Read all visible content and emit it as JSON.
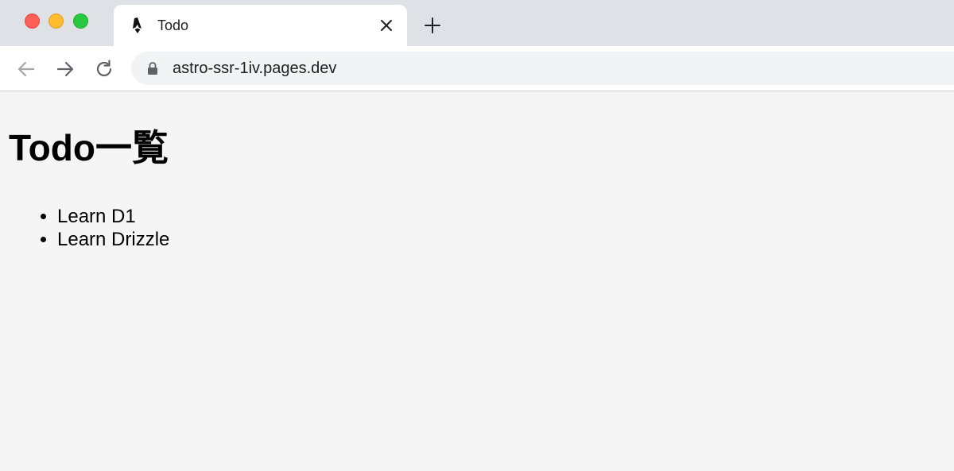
{
  "browser": {
    "tab": {
      "title": "Todo",
      "favicon": "astro-logo-icon"
    },
    "new_tab_icon": "plus-icon",
    "close_tab_icon": "close-icon",
    "nav": {
      "back_icon": "arrow-left-icon",
      "forward_icon": "arrow-right-icon",
      "reload_icon": "reload-icon"
    },
    "address_bar": {
      "url": "astro-ssr-1iv.pages.dev",
      "lock_icon": "lock-icon"
    }
  },
  "page": {
    "heading": "Todo一覧",
    "todos": [
      {
        "label": "Learn D1"
      },
      {
        "label": "Learn Drizzle"
      }
    ]
  },
  "colors": {
    "tabstrip": "#dee1e6",
    "traffic_red": "#ff5f57",
    "traffic_yellow": "#febc2e",
    "traffic_green": "#28c840",
    "page_background": "#f5f5f5"
  }
}
